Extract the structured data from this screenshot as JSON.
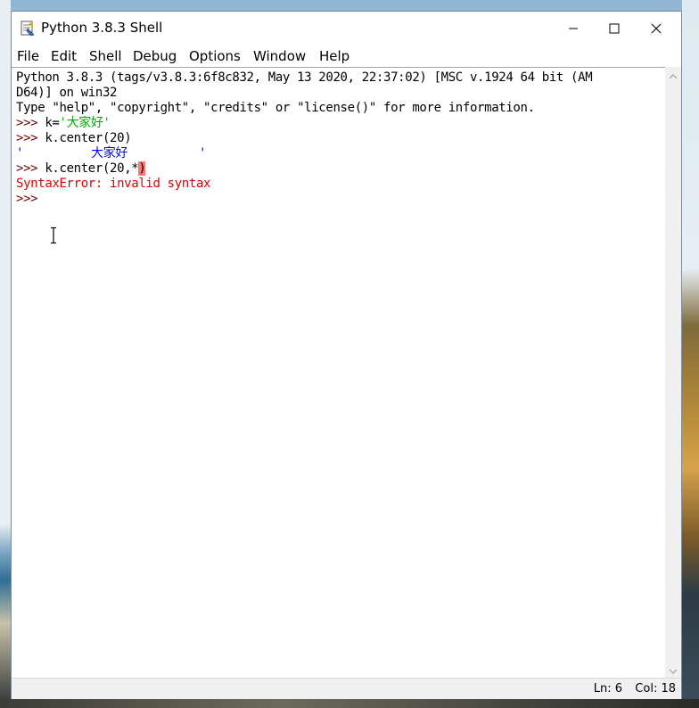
{
  "window": {
    "title": "Python 3.8.3 Shell",
    "controls": {
      "minimize": "minimize-icon",
      "maximize": "maximize-icon",
      "close": "close-icon"
    }
  },
  "menubar": {
    "items": [
      "File",
      "Edit",
      "Shell",
      "Debug",
      "Options",
      "Window",
      "Help"
    ]
  },
  "shell": {
    "banner1": "Python 3.8.3 (tags/v3.8.3:6f8c832, May 13 2020, 22:37:02) [MSC v.1924 64 bit (AM",
    "banner2": "D64)] on win32",
    "banner3": "Type \"help\", \"copyright\", \"credits\" or \"license()\" for more information.",
    "prompt": ">>> ",
    "cmd1_code": "k=",
    "cmd1_str": "'大家好'",
    "cmd2_code": "k.center(20)",
    "out2_open": "'",
    "out2_value": "大家好",
    "out2_close": "'",
    "cmd3_code": "k.center(20,*",
    "cmd3_err_char": ")",
    "error": "SyntaxError: invalid syntax",
    "prompt_last": ">>> "
  },
  "statusbar": {
    "ln": "Ln: 6",
    "col": "Col: 18"
  },
  "colors": {
    "prompt": "#770000",
    "string": "#00aa00",
    "output": "#0000ff",
    "error": "#dd0000",
    "error_highlight": "#ff7777"
  }
}
